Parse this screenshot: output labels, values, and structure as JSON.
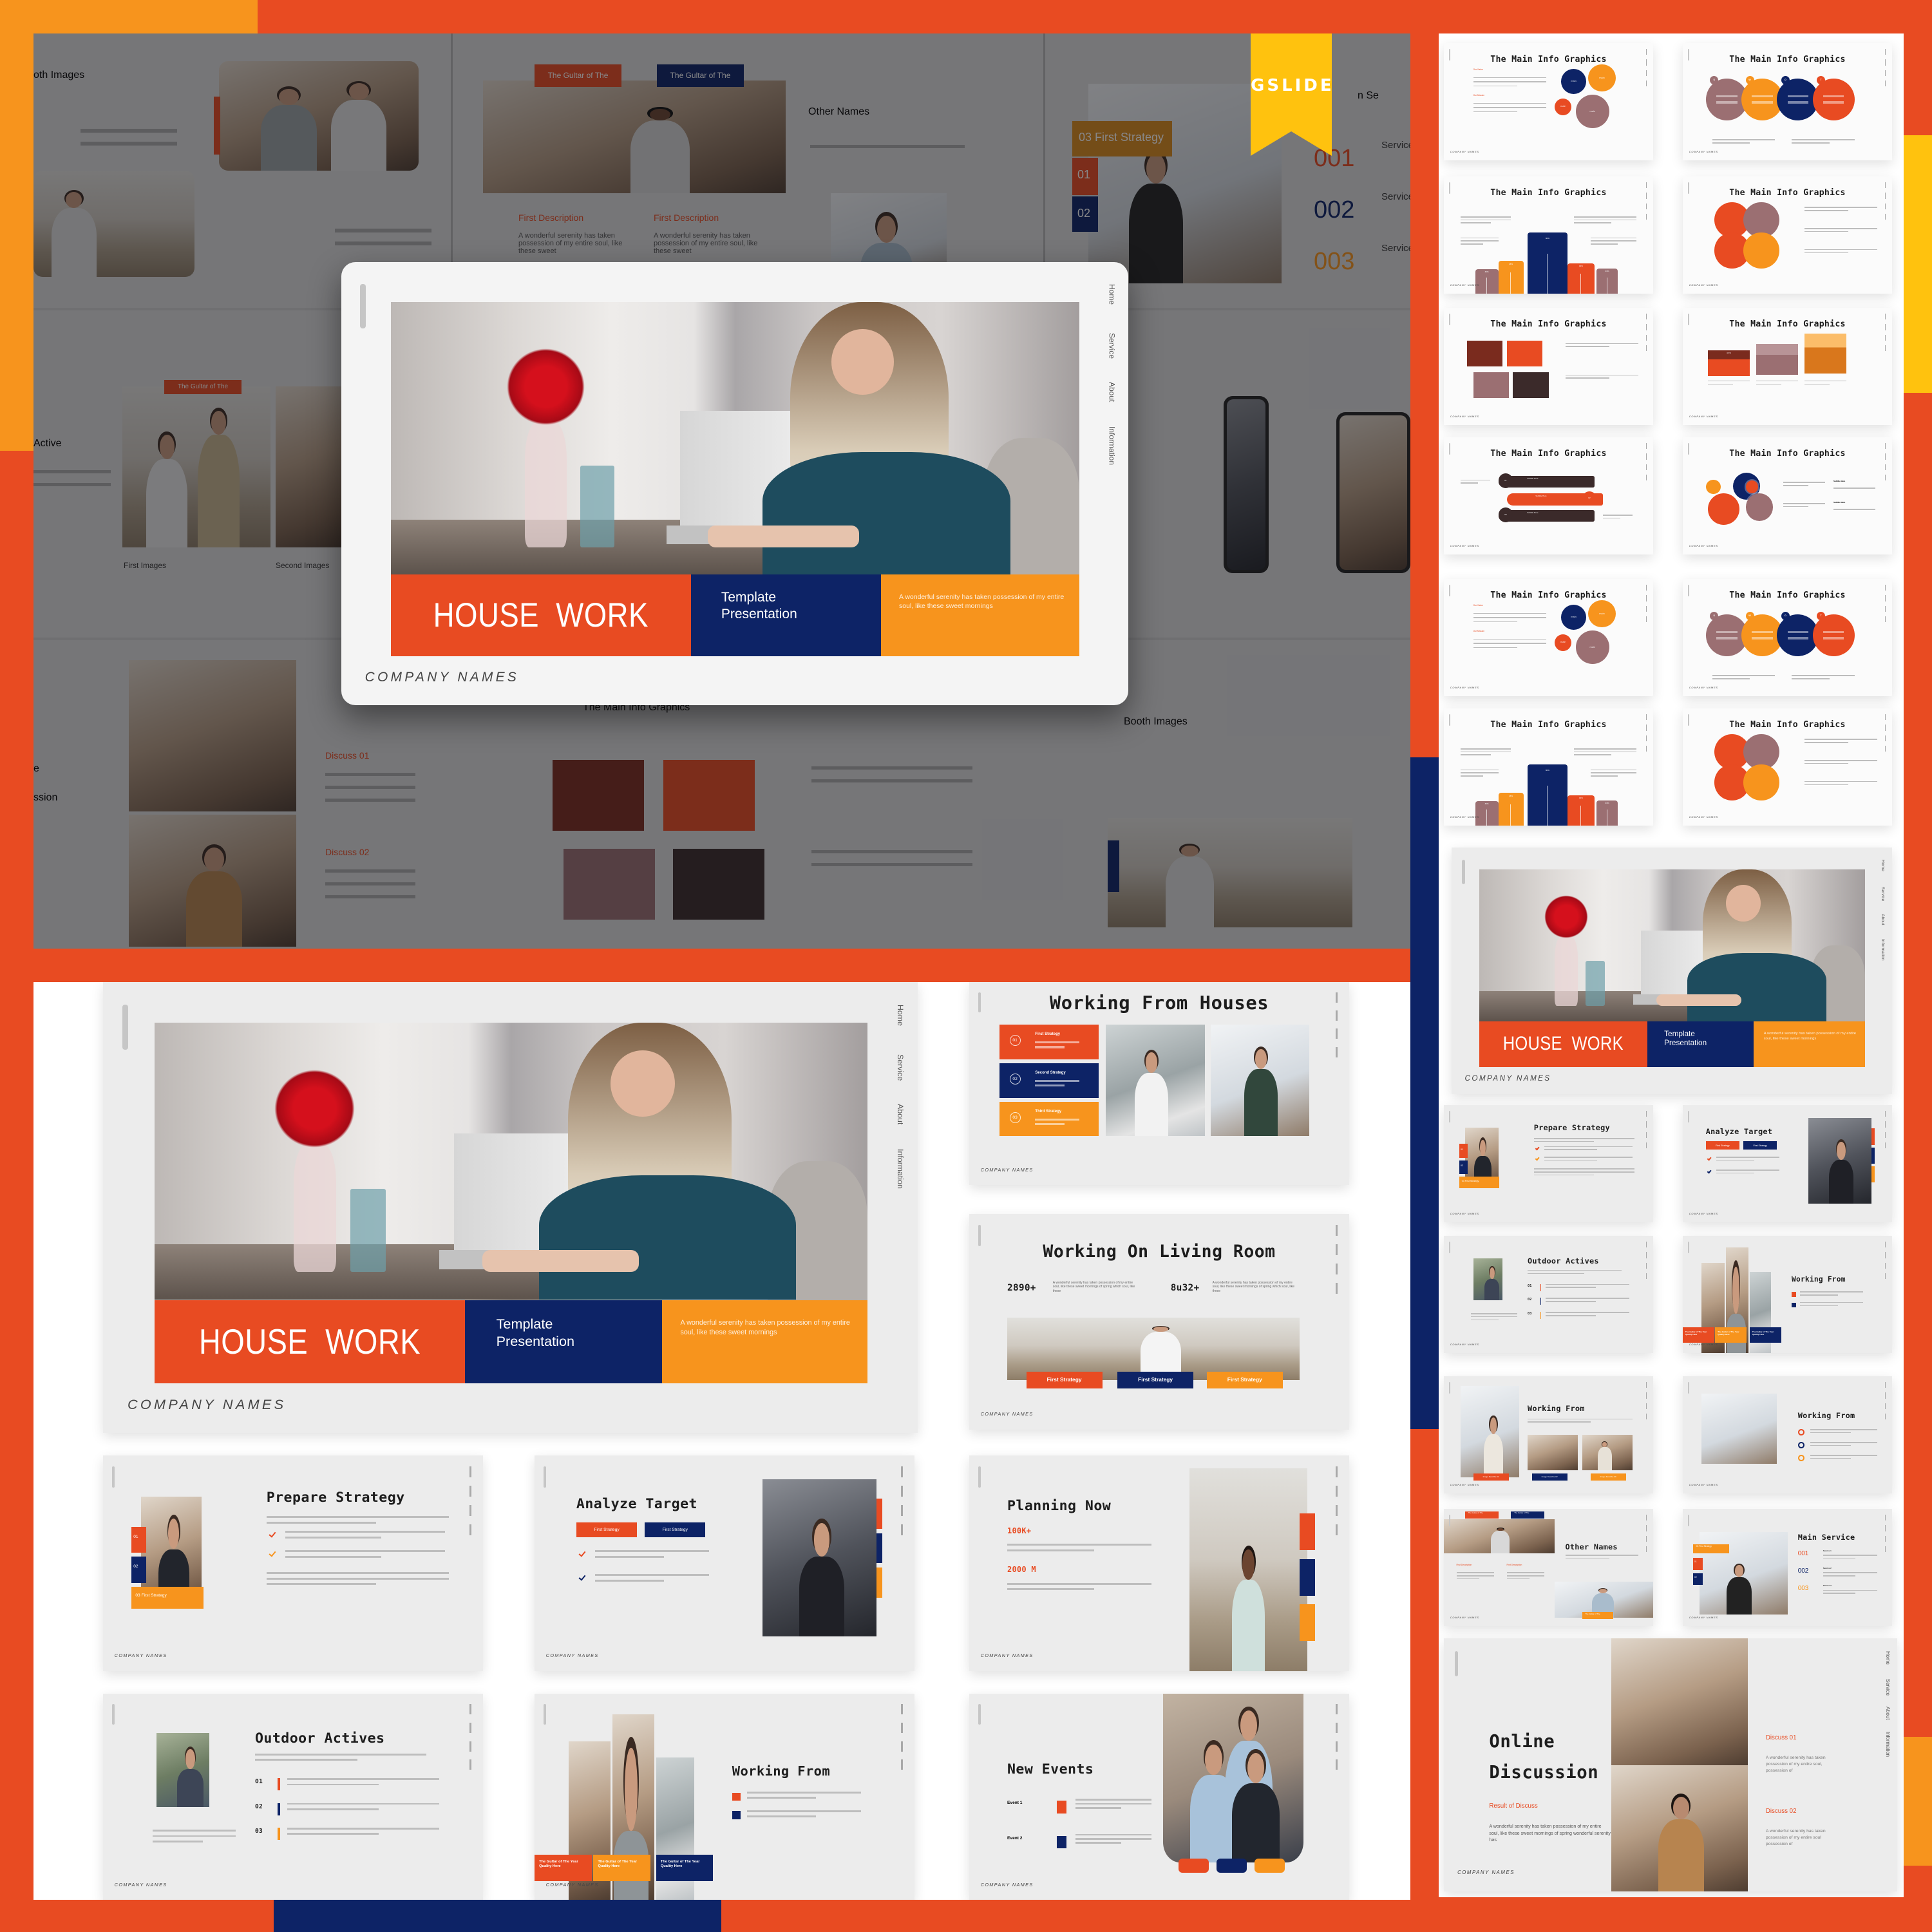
{
  "colors": {
    "red": "#e84b22",
    "navy": "#0d2366",
    "orange": "#f7941d",
    "yellow": "#ffc20e",
    "mauve": "#9b6f72",
    "maroon": "#7a2b1e",
    "dark": "#3b2a2a",
    "background": "#e84b22"
  },
  "brand": {
    "badge": "GSLIDE"
  },
  "common": {
    "company": "COMPANY NAMES",
    "nav": [
      "Home",
      "Service",
      "About",
      "Information"
    ]
  },
  "cover": {
    "title": "HOUSE  WORK",
    "subtitle": [
      "Template",
      "Presentation"
    ],
    "tagline": "A wonderful serenity has taken possession of my entire soul, like these sweet mornings"
  },
  "background": {
    "booth_partial": {
      "title": "oth Images"
    },
    "other_names": {
      "tags": [
        "The Gultar of The",
        "The Gultar of The"
      ],
      "title": "Other Names",
      "desc_titles": [
        "First Description",
        "First Description"
      ],
      "desc": "A wonderful serenity has taken possession of my entire soul, like these sweet"
    },
    "main_service": {
      "title": "n Se",
      "tags": [
        "03   First Strategy",
        "01",
        "02"
      ],
      "numbers": [
        "001",
        "002",
        "003"
      ],
      "service": "Service"
    },
    "active": {
      "title": "Active",
      "tag": "The Gultar of The",
      "captions": [
        "First Images",
        "Second Images"
      ]
    },
    "discussion": {
      "title": [
        "e",
        "ssion"
      ],
      "discuss": [
        "Discuss 01",
        "Discuss 02"
      ]
    },
    "info": {
      "title": "The Main Info Graphics"
    },
    "booth": {
      "title": "Booth Images"
    }
  },
  "slides": {
    "houses": {
      "title": "Working From Houses",
      "items": [
        {
          "num": "01",
          "label": "First Strategy"
        },
        {
          "num": "02",
          "label": "Second Strategy"
        },
        {
          "num": "03",
          "label": "Third Strategy"
        }
      ]
    },
    "living": {
      "title": "Working On Living Room",
      "stats": [
        {
          "value": "2890+",
          "text": "A wonderful serenity has taken possession of my entire soul, like these sweet mornings of spring which soul, like these"
        },
        {
          "value": "8u32+",
          "text": "A wonderful serenity has taken possession of my entire soul, like these sweet mornings of spring which soul, like these"
        }
      ],
      "tags": [
        "First Strategy",
        "First Strategy",
        "First Strategy"
      ]
    },
    "prepare": {
      "title": "Prepare Strategy",
      "tags": [
        "01",
        "02",
        "03  First Strategy"
      ]
    },
    "analyze": {
      "title": "Analyze Target",
      "tags": [
        "First Strategy",
        "First Strategy"
      ]
    },
    "planning": {
      "title": "Planning Now",
      "stats": [
        "100K+",
        "2000 M"
      ]
    },
    "outdoor": {
      "title": "Outdoor Actives",
      "items": [
        "01",
        "02",
        "03"
      ]
    },
    "working_from": {
      "title": "Working From",
      "tags": [
        "The Gultar of The Year Quality Here",
        "The Gultar of The Year Quality Here",
        "The Gultar of The Year Quality Here"
      ]
    },
    "new_events": {
      "title": "New Events",
      "events": [
        "Event 1",
        "Event 2"
      ]
    },
    "working_from_b": {
      "title": "Working From",
      "tags": [
        "Image Describe 01",
        "Image Describe 02",
        "Image Describe 03"
      ]
    },
    "working_from_c": {
      "title": "Working From"
    },
    "other_names": {
      "title": "Other Names",
      "tags": [
        "The Gultar of The",
        "The Gultar of The",
        "The Gultar of The"
      ],
      "desc_titles": [
        "First Description",
        "First Description"
      ]
    },
    "main_service": {
      "title": "Main Service",
      "numbers": [
        "001",
        "002",
        "003"
      ],
      "services": [
        "Service 1",
        "Service 2",
        "Service 3"
      ],
      "tags": [
        "03  First Strategy",
        "01",
        "02"
      ]
    },
    "online": {
      "title": [
        "Online",
        "Discussion"
      ],
      "subtitle": "Result of Discuss",
      "text": "A wonderful serenity has taken possession of my entire soul, like these sweet mornings of spring wonderful serenity has",
      "discuss": [
        {
          "title": "Discuss 01",
          "text": "A wonderful serenity has taken possession of my entire soul, possession of"
        },
        {
          "title": "Discuss 02",
          "text": "A wonderful serenity has taken possession of my entire soul possession of"
        }
      ]
    }
  },
  "info_graphics": {
    "title": "The Main Info Graphics",
    "vision": "Our Vision",
    "mission": "Our Mission",
    "bubble": "main",
    "swot": [
      "S",
      "W",
      "O",
      "T"
    ],
    "bars": [
      {
        "label": "32%",
        "value": 32
      },
      {
        "label": "43%",
        "value": 43
      },
      {
        "label": "80%",
        "value": 80
      },
      {
        "label": "40%",
        "value": 40
      },
      {
        "label": "33%",
        "value": 33
      }
    ],
    "cube_label": "43 %",
    "arrows": [
      "01",
      "02",
      "03"
    ],
    "subtitle": "Subtitle Here"
  }
}
